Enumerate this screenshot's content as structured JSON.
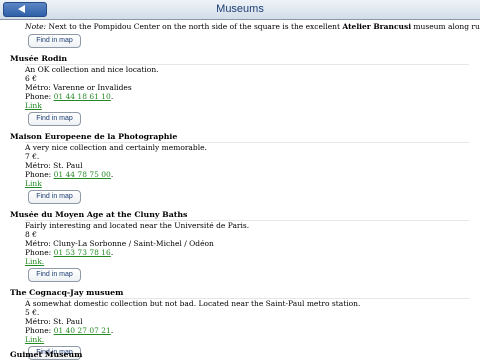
{
  "header": {
    "title": "Museums",
    "back_icon": "back-arrow-icon"
  },
  "intro": {
    "note_label": "Note:",
    "note_text": " Next to the Pompidou Center on the north side of the square is the excellent ",
    "note_bold": "Atelier Brancusi",
    "note_tail": " museum along rue Rambuteau.",
    "map_button": "Find in map"
  },
  "museums": [
    {
      "name": "Musée Rodin",
      "description": "An OK collection and nice location.",
      "price": "6 €",
      "metro": "Métro: Varenne or Invalides",
      "phone_label": "Phone: ",
      "phone": "01 44 18 61 10",
      "phone_tail": ".",
      "link": "Link",
      "map_button": "Find in map"
    },
    {
      "name": "Maison Europeene de la Photographie",
      "description": "A very nice collection and certainly memorable.",
      "price": "7 €.",
      "metro": "Métro: St. Paul",
      "phone_label": "Phone: ",
      "phone": "01 44 78 75 00",
      "phone_tail": ".",
      "link": "Link",
      "map_button": "Find in map"
    },
    {
      "name": "Musée du Moyen Age at the Cluny Baths",
      "description": "Fairly interesting and located near the Université de Paris.",
      "price": "8 €",
      "metro": "Métro: Cluny-La Sorbonne / Saint-Michel / Odéon",
      "phone_label": "Phone: ",
      "phone": "01 53 73 78 16",
      "phone_tail": ".",
      "link": "Link",
      "link_tail": ".",
      "map_button": "Find in map"
    },
    {
      "name": "The Cognacq-Jay musuem",
      "description": "A somewhat domestic collection but not bad. Located near the Saint-Paul metro station.",
      "price": "5 €.",
      "metro": "Métro: St. Paul",
      "phone_label": "Phone: ",
      "phone": "01 40 27 07 21",
      "phone_tail": ".",
      "link": "Link",
      "link_tail": ".",
      "map_button": "Find in map"
    },
    {
      "name": "Guimet Museum"
    }
  ],
  "colors": {
    "link": "#238a23",
    "title": "#1c3f73",
    "back_button": "#2f5fa8"
  }
}
